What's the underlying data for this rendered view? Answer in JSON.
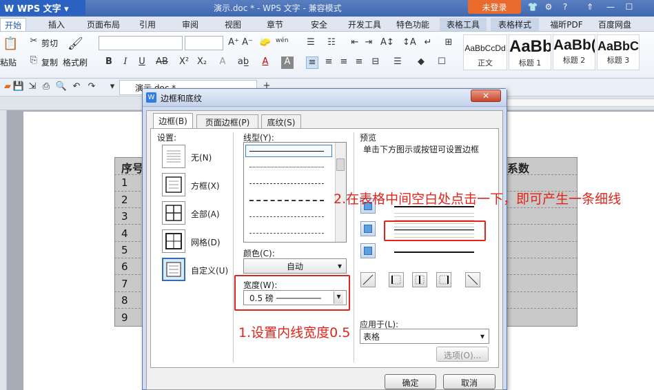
{
  "app": {
    "name": "WPS 文字",
    "doc_title": "演示.doc * - WPS 文字 - 兼容模式",
    "login": "未登录"
  },
  "ribbon_tabs": [
    "开始",
    "插入",
    "页面布局",
    "引用",
    "审阅",
    "视图",
    "章节",
    "安全",
    "开发工具",
    "特色功能",
    "表格工具",
    "表格样式",
    "福昕PDF",
    "百度网盘"
  ],
  "ribbon": {
    "cut": "剪切",
    "paste": "粘贴",
    "copy": "复制",
    "format_painter": "格式刷",
    "styles": [
      {
        "sample": "AaBbCcDd",
        "name": "正文"
      },
      {
        "sample": "AaBb",
        "name": "标题 1"
      },
      {
        "sample": "AaBb(",
        "name": "标题 2"
      },
      {
        "sample": "AaBbC",
        "name": "标题 3"
      }
    ]
  },
  "doc_tab": "演示.doc *",
  "document": {
    "header_left": "序号",
    "header_right": "系数",
    "rows": [
      "1",
      "2",
      "3",
      "4",
      "5",
      "6",
      "7",
      "8",
      "9"
    ]
  },
  "dialog": {
    "title": "边框和底纹",
    "tabs": [
      "边框(B)",
      "页面边框(P)",
      "底纹(S)"
    ],
    "settings_label": "设置:",
    "settings": [
      "无(N)",
      "方框(X)",
      "全部(A)",
      "网格(D)",
      "自定义(U)"
    ],
    "linestyle_label": "线型(Y):",
    "color_label": "颜色(C):",
    "color_value": "自动",
    "width_label": "宽度(W):",
    "width_value": "0.5  磅 ─────────",
    "preview_label": "预览",
    "preview_hint": "单击下方图示或按钮可设置边框",
    "apply_label": "应用于(L):",
    "apply_value": "表格",
    "options_button": "选项(O)...",
    "ok": "确定",
    "cancel": "取消"
  },
  "annotations": {
    "step1": "1.设置内线宽度0.5",
    "step2": "2.在表格中间空白处点击一下，即可产生一条细线"
  },
  "colors": {
    "annotation": "#e2231a",
    "title_accent": "#2b62c2"
  }
}
